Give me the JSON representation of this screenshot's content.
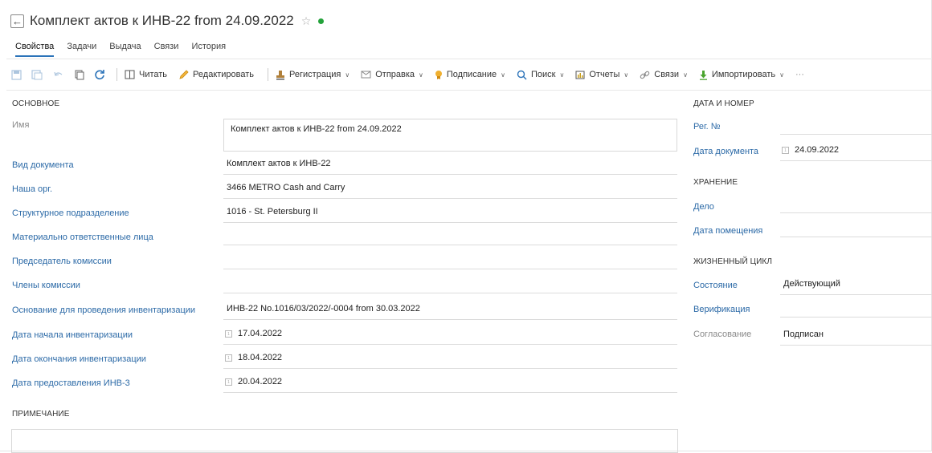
{
  "header": {
    "title": "Комплект актов к ИНВ-22 from 24.09.2022",
    "status_color": "#23a23a"
  },
  "tabs": [
    {
      "label": "Свойства",
      "active": true
    },
    {
      "label": "Задачи"
    },
    {
      "label": "Выдача"
    },
    {
      "label": "Связи"
    },
    {
      "label": "История"
    }
  ],
  "toolbar": {
    "read": "Читать",
    "edit": "Редактировать",
    "registration": "Регистрация",
    "send": "Отправка",
    "signing": "Подписание",
    "search": "Поиск",
    "reports": "Отчеты",
    "links": "Связи",
    "import": "Импортировать",
    "more": "···"
  },
  "main": {
    "section_title": "ОСНОВНОЕ",
    "name_label": "Имя",
    "name_value": "Комплект актов к ИНВ-22 from 24.09.2022",
    "doc_kind_label": "Вид документа",
    "doc_kind_value": "Комплект актов к ИНВ-22",
    "org_label": "Наша орг.",
    "org_value": "3466 METRO Cash and Carry",
    "dept_label": "Структурное подразделение",
    "dept_value": "1016 - St. Petersburg II",
    "mol_label": "Материально ответственные лица",
    "mol_value": "",
    "chair_label": "Председатель комиссии",
    "chair_value": "",
    "members_label": "Члены комиссии",
    "members_value": "",
    "basis_label": "Основание для проведения инвентаризации",
    "basis_value": "ИНВ-22 No.1016/03/2022/-0004 from 30.03.2022",
    "start_label": "Дата начала инвентаризации",
    "start_value": "17.04.2022",
    "end_label": "Дата окончания инвентаризации",
    "end_value": "18.04.2022",
    "inv3_label": "Дата предоставления ИНВ-3",
    "inv3_value": "20.04.2022",
    "note_title": "ПРИМЕЧАНИЕ"
  },
  "side": {
    "datenum_title": "ДАТА И НОМЕР",
    "regnum_label": "Рег. №",
    "regnum_value": "",
    "docdate_label": "Дата документа",
    "docdate_value": "24.09.2022",
    "storage_title": "ХРАНЕНИЕ",
    "case_label": "Дело",
    "case_value": "",
    "placedate_label": "Дата помещения",
    "placedate_value": "",
    "lifecycle_title": "ЖИЗНЕННЫЙ ЦИКЛ",
    "state_label": "Состояние",
    "state_value": "Действующий",
    "verify_label": "Верификация",
    "verify_value": "",
    "approval_label": "Согласование",
    "approval_value": "Подписан"
  }
}
